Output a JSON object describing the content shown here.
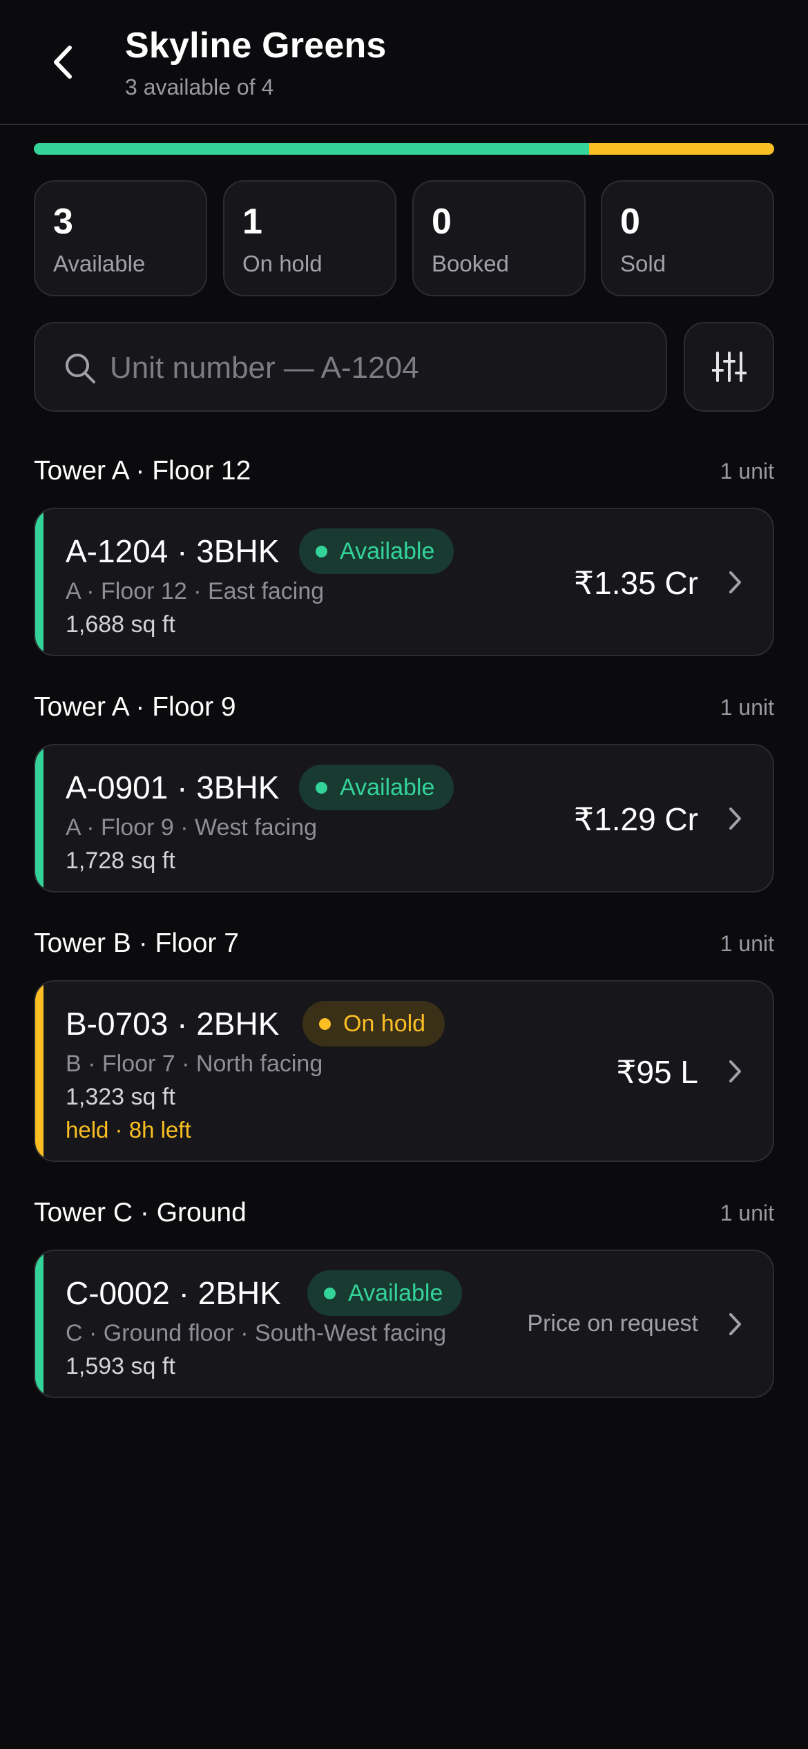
{
  "header": {
    "title": "Skyline Greens",
    "subtitle": "3 available of 4"
  },
  "progress": {
    "available_fraction": 0.75,
    "on_hold_fraction": 0.25
  },
  "colors": {
    "available": "#34d399",
    "on_hold": "#fbbf24",
    "background": "#0b0b0e",
    "card": "#17171b"
  },
  "stats": [
    {
      "value": "3",
      "label": "Available"
    },
    {
      "value": "1",
      "label": "On hold"
    },
    {
      "value": "0",
      "label": "Booked"
    },
    {
      "value": "0",
      "label": "Sold"
    }
  ],
  "search": {
    "placeholder": "Unit number — A-1204",
    "value": ""
  },
  "icons": {
    "back": "chevron-left-icon",
    "search": "search-icon",
    "filter": "sliders-icon",
    "row": "chevron-right-icon"
  },
  "sections": [
    {
      "name": "Tower A · Floor 12",
      "count": "1 unit",
      "unit": {
        "title": "A-1204 · 3BHK",
        "status": "Available",
        "meta": "A · Floor 12 · East facing",
        "area": "1,688 sq ft",
        "price": "₹1.35 Cr"
      }
    },
    {
      "name": "Tower A · Floor 9",
      "count": "1 unit",
      "unit": {
        "title": "A-0901 · 3BHK",
        "status": "Available",
        "meta": "A · Floor 9 · West facing",
        "area": "1,728 sq ft",
        "price": "₹1.29 Cr"
      }
    },
    {
      "name": "Tower B · Floor 7",
      "count": "1 unit",
      "unit": {
        "title": "B-0703 · 2BHK",
        "status": "On hold",
        "meta": "B · Floor 7 · North facing",
        "area": "1,323 sq ft",
        "hold_note": "held · 8h left",
        "price": "₹95 L"
      }
    },
    {
      "name": "Tower C · Ground",
      "count": "1 unit",
      "unit": {
        "title": "C-0002 · 2BHK",
        "status": "Available",
        "meta": "C · Ground floor · South-West facing",
        "area": "1,593 sq ft",
        "price": "Price on request"
      }
    }
  ]
}
